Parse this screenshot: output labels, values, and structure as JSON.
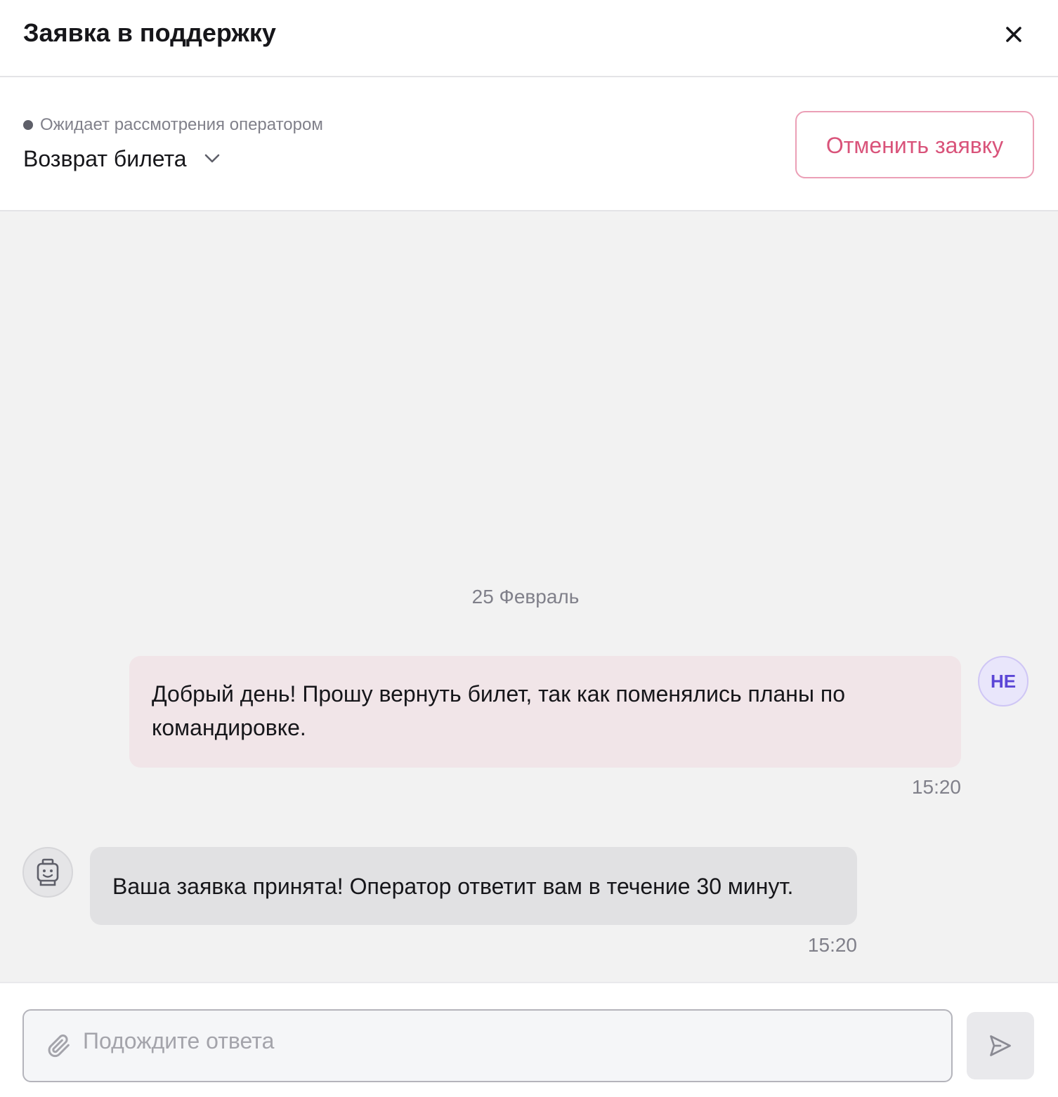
{
  "header": {
    "title": "Заявка в поддержку",
    "close_icon": "close-icon"
  },
  "ticket": {
    "status_text": "Ожидает рассмотрения оператором",
    "status_color": "#5e5f69",
    "topic": "Возврат билета",
    "cancel_label": "Отменить заявку",
    "cancel_color": "#d9537a"
  },
  "chat": {
    "date_separator": "25 Февраль",
    "messages": [
      {
        "sender": "user",
        "avatar_initials": "НЕ",
        "text": "Добрый день! Прошу вернуть билет, так как поменялись планы по командировке.",
        "time": "15:20"
      },
      {
        "sender": "bot",
        "avatar_icon": "robot-icon",
        "text": "Ваша заявка принята! Оператор ответит вам в течение 30 минут.",
        "time": "15:20"
      }
    ]
  },
  "composer": {
    "placeholder": "Подождите ответа",
    "attach_icon": "paperclip-icon",
    "send_icon": "send-icon"
  }
}
